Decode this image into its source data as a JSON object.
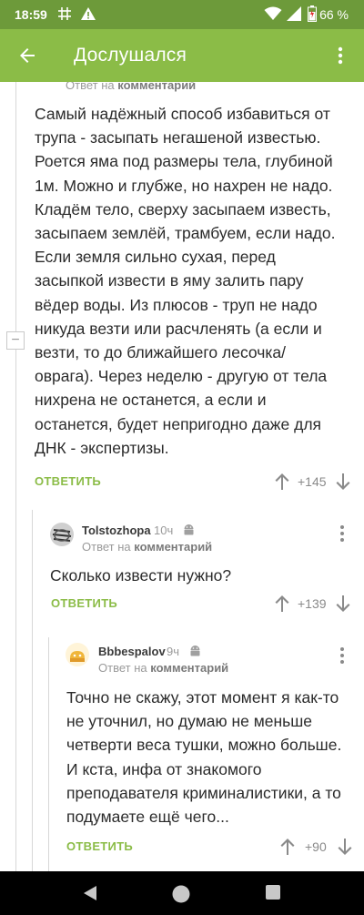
{
  "status_bar": {
    "time": "18:59",
    "battery_percent": "66 %",
    "icons": [
      "hash-grid-icon",
      "warning-icon",
      "wifi-icon",
      "signal-icon",
      "battery-icon"
    ]
  },
  "app_bar": {
    "title": "Дослушался",
    "back_icon": "arrow-left-icon",
    "menu_icon": "more-vertical-icon"
  },
  "top_partial": {
    "reply_prefix": "Ответ на",
    "reply_target": "комментарий"
  },
  "comments": [
    {
      "text": "Самый надёжный способ избавиться от трупа - засыпать негашеной известью. Роется яма под размеры тела, глубиной 1м. Можно и глубже, но нахрен не надо. Кладём тело, сверху засыпаем известь, засыпаем землёй, трамбуем, если надо. Если земля сильно сухая, перед засыпкой извести в яму залить пару вёдер воды. Из плюсов - труп не надо никуда везти или расчленять (а если и везти, то до ближайшего лесочка/ оврага). Через неделю - другую от тела нихрена не останется, а если и останется, будет непригодно даже для ДНК - экспертизы.",
      "reply_label": "ОТВЕТИТЬ",
      "score": "+145"
    },
    {
      "author": "Tolstozhopa",
      "time": "10ч",
      "reply_prefix": "Ответ на",
      "reply_target": "комментарий",
      "text": "Сколько извести нужно?",
      "reply_label": "ОТВЕТИТЬ",
      "score": "+139"
    },
    {
      "author": "Bbbespalov",
      "time": "9ч",
      "reply_prefix": "Ответ на",
      "reply_target": "комментарий",
      "text": "Точно не скажу, этот момент я как-то не уточнил, но думаю не меньше четверти веса тушки, можно больше. И кста, инфа от знакомого преподавателя криминалистики, а то подумаете ещё чего...",
      "reply_label": "ОТВЕТИТЬ",
      "score": "+90"
    }
  ],
  "collapse_symbol": "−",
  "colors": {
    "status_bar": "#6d9a3a",
    "app_bar": "#8bbc47",
    "accent": "#8bbc47",
    "text": "#2b2b2b",
    "muted": "#9a9a9a"
  }
}
